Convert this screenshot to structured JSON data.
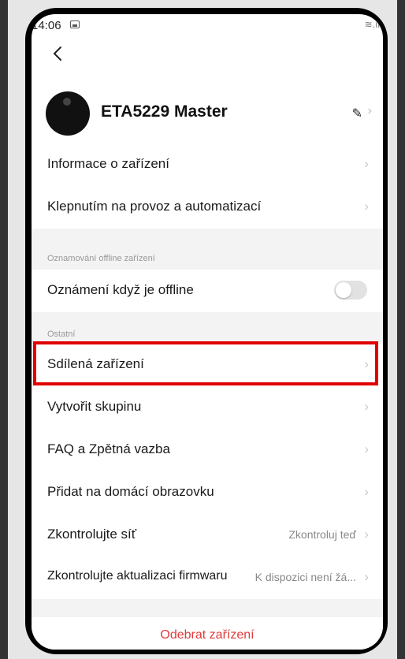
{
  "status_bar": {
    "time": "14:06",
    "signal_text": "≋.ıl"
  },
  "device": {
    "name": "ETA5229 Master"
  },
  "menu": {
    "items_top": [
      {
        "label": "Informace o zařízení"
      },
      {
        "label": "Klepnutím na provoz a automatizací"
      }
    ],
    "offline_section_title": "Oznamování offline zařízení",
    "offline_toggle_label": "Oznámení když je offline",
    "offline_toggle_on": false,
    "other_section_title": "Ostatní",
    "items_other": [
      {
        "label": "Sdílená zařízení"
      },
      {
        "label": "Vytvořit skupinu"
      },
      {
        "label": "FAQ a Zpětná vazba"
      },
      {
        "label": "Přidat na domácí obrazovku"
      }
    ],
    "check_network": {
      "label": "Zkontrolujte síť",
      "value": "Zkontroluj teď"
    },
    "firmware": {
      "label": "Zkontrolujte aktualizaci firmwaru",
      "value": "K dispozici není žá..."
    },
    "remove_label": "Odebrat zařízení"
  },
  "colors": {
    "highlight": "#e00000",
    "remove_text": "#e03b3b"
  }
}
